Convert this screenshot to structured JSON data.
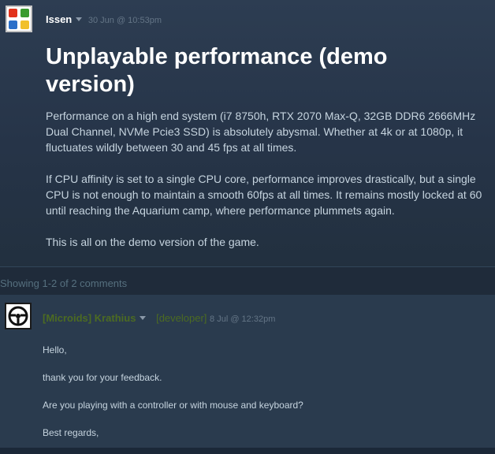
{
  "post": {
    "author": "Issen",
    "timestamp": "30 Jun @ 10:53pm",
    "title": "Unplayable performance (demo version)",
    "paragraphs": [
      "Performance on a high end system (i7 8750h, RTX 2070 Max-Q, 32GB DDR6 2666MHz Dual Channel, NVMe Pcie3 SSD) is absolutely abysmal. Whether at 4k or at 1080p, it fluctuates wildly between 30 and 45 fps at all times.",
      "If CPU affinity is set to a single CPU core, performance improves drastically, but a single CPU is not enough to maintain a smooth 60fps at all times. It remains mostly locked at 60 until reaching the Aquarium camp, where performance plummets again.",
      "This is all on the demo version of the game."
    ],
    "avatar_icon": "game-tiles-avatar-icon"
  },
  "comments_count": "Showing 1-2 of 2 comments",
  "comment": {
    "author": "[Microids] Krathius",
    "tag": "[developer]",
    "timestamp": "8 Jul @ 12:32pm",
    "avatar_icon": "steering-wheel-avatar-icon",
    "lines": [
      "Hello,",
      "thank you for your feedback.",
      "Are you playing with a controller or with mouse and keyboard?",
      "Best regards,"
    ]
  },
  "colors": {
    "background": "#1b2838",
    "post_bg": "#263448",
    "comment_bg": "#2a3b4e",
    "developer_name": "#4c6b22",
    "text": "#c6d4df"
  }
}
